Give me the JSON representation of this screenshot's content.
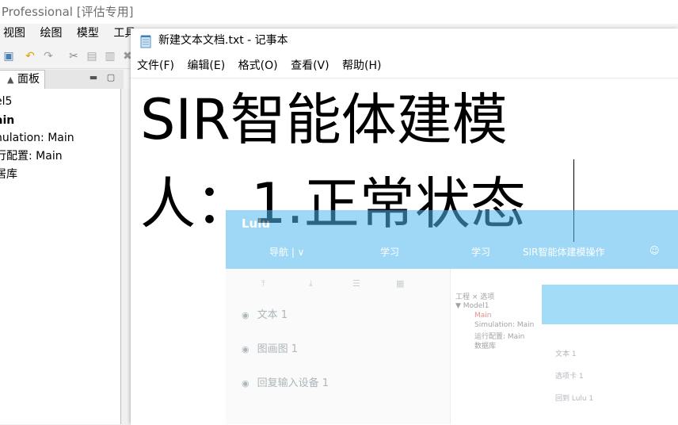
{
  "ide": {
    "title": ": Professional [评估专用]",
    "menu": [
      "视图",
      "绘图",
      "模型",
      "工具"
    ],
    "panel_tab": "面板",
    "tree": [
      "el5",
      "ain",
      "nulation: Main",
      "行配置: Main",
      "居库"
    ]
  },
  "notepad": {
    "title": "新建文本文档.txt - 记事本",
    "menu": [
      "文件(F)",
      "编辑(E)",
      "格式(O)",
      "查看(V)",
      "帮助(H)"
    ],
    "lines": [
      "SIR智能体建模",
      "人：1.正常状态"
    ]
  },
  "overlay": {
    "logo": "Lulu",
    "tabs": [
      "导航 | ∨",
      "学习",
      "学习",
      "SIR智能体建模操作",
      "☺"
    ],
    "items": [
      "文本 1",
      "图画图 1",
      "回复输入设备 1"
    ],
    "inner_tree": [
      "工程  × 选项",
      "▼ Model1",
      "Main",
      "Simulation: Main",
      "运行配置: Main",
      "数据库"
    ],
    "inner_items": [
      "文本 1",
      "选项卡 1",
      "回到 Lulu 1"
    ]
  }
}
